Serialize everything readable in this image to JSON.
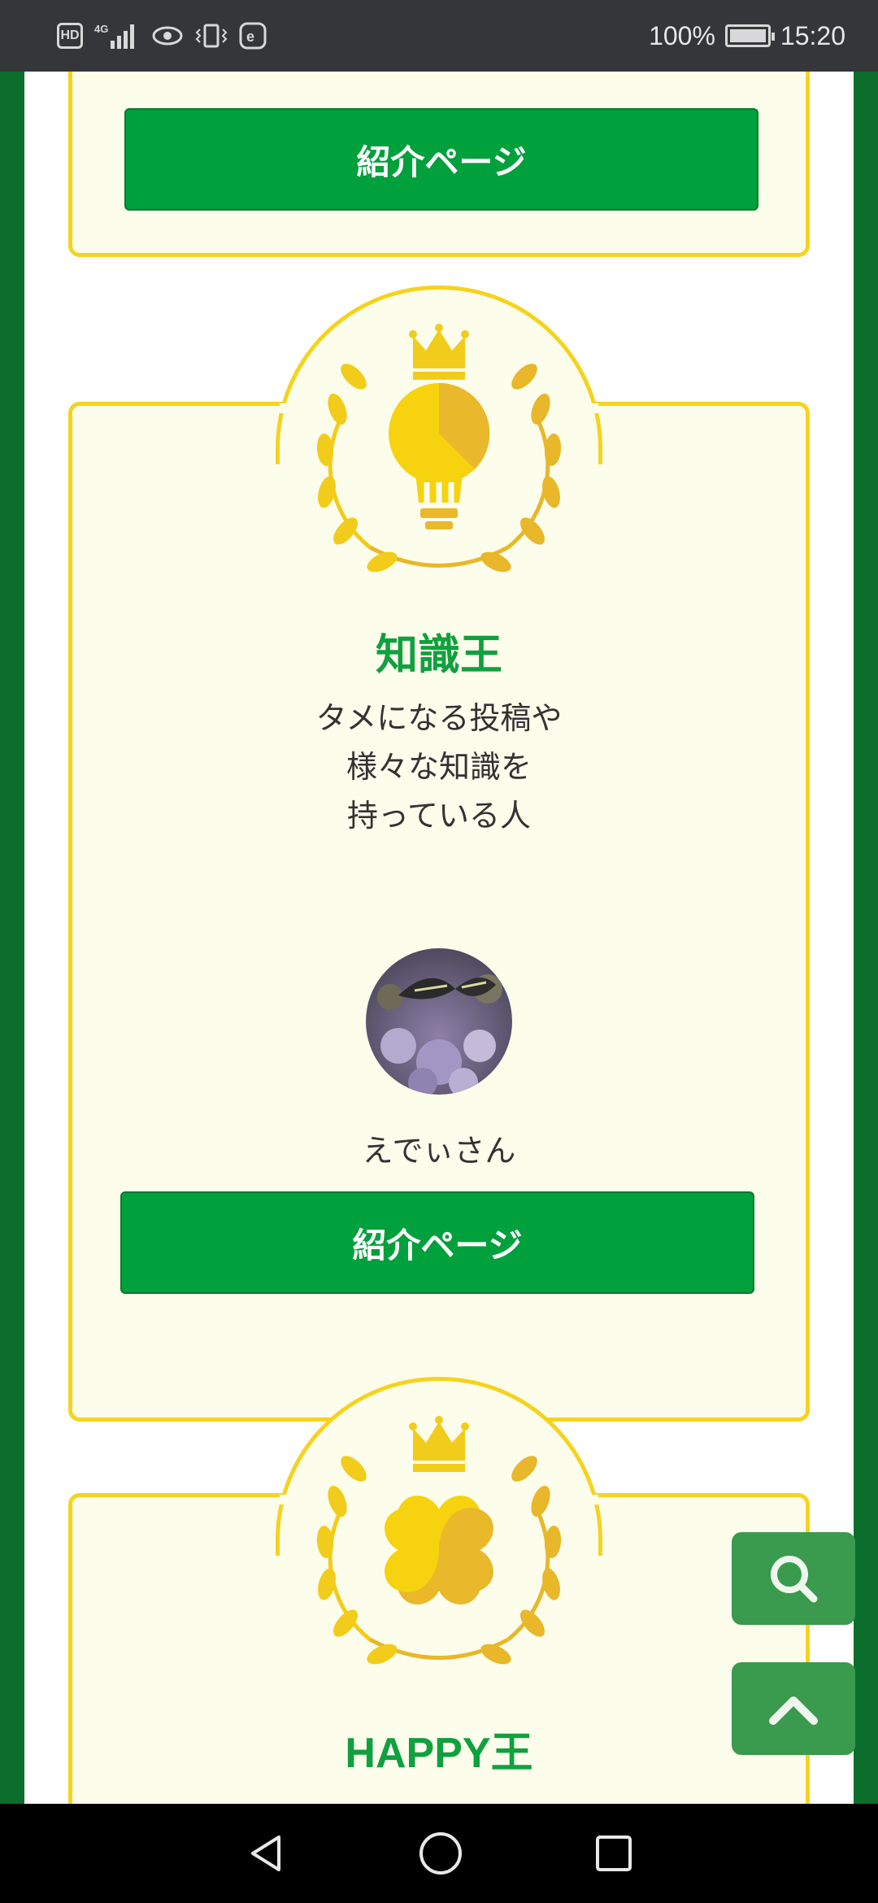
{
  "status_bar": {
    "left_icons": [
      "hd-icon",
      "4g-signal-icon",
      "eye-icon",
      "vibrate-icon",
      "e-icon"
    ],
    "battery": "100%",
    "time": "15:20"
  },
  "cards": [
    {
      "button_label": "紹介ページ"
    },
    {
      "icon": "lightbulb-icon",
      "title": "知識王",
      "description_lines": [
        "タメになる投稿や",
        "様々な知識を",
        "持っている人"
      ],
      "username": "えでぃさん",
      "button_label": "紹介ページ"
    },
    {
      "icon": "clover-icon",
      "title": "HAPPY王"
    }
  ],
  "floating": {
    "search_icon": "search-icon",
    "top_icon": "chevron-up-icon"
  },
  "nav": {
    "back": "back-icon",
    "home": "home-icon",
    "recents": "recents-icon"
  },
  "colors": {
    "green": "#10a13e",
    "button_green": "#00a03c",
    "gold": "#f5d31e",
    "card_bg": "#fdfdec"
  }
}
